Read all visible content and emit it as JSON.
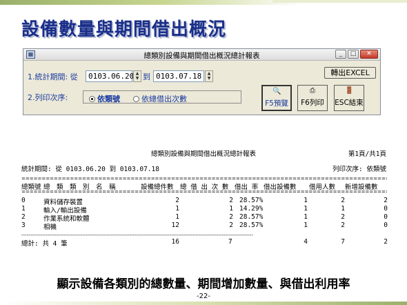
{
  "slide": {
    "title": "設備數量與期間借出概況",
    "caption": "顯示設備各類別的總數量、期間增加數量、與借出利用率",
    "page_number": "-22-"
  },
  "window": {
    "title": "總類別設備與期間借出概況總計報表",
    "controls": {
      "minimize": "_",
      "maximize": "□",
      "close": "✕"
    },
    "period_label": "1.統計期間: 從",
    "date_from": "0103.06.20",
    "to_label": "到",
    "date_to": "0103.07.18",
    "order_label": "2.列印次序:",
    "radio_options": [
      {
        "label": "依類號",
        "selected": true
      },
      {
        "label": "依總借出次數",
        "selected": false
      }
    ],
    "buttons": {
      "excel": "轉出EXCEL",
      "preview": "F5預覽",
      "print": "F6列印",
      "exit": "ESC結束"
    }
  },
  "report": {
    "title": "總類別設備與期間借出概況總計報表",
    "page": "第1頁/共1頁",
    "period": "統計期間: 從 0103.06.20 到 0103.07.18",
    "order": "列印次序: 依類號",
    "columns": [
      "總類號",
      "總　類　類　別　名　稱",
      "設備總件數",
      "總 借 出 次 數",
      "借出 率",
      "借出設備數",
      "借用人數",
      "新增設備數"
    ],
    "rows": [
      {
        "code": "0",
        "name": "資料儲存裝置",
        "total": "2",
        "loans": "2",
        "rate": "28.57%",
        "loaned": "1",
        "borrowers": "2",
        "added": "2"
      },
      {
        "code": "1",
        "name": "輸入/輸出設備",
        "total": "1",
        "loans": "1",
        "rate": "14.29%",
        "loaned": "1",
        "borrowers": "1",
        "added": "0"
      },
      {
        "code": "2",
        "name": "作業系統和軟體",
        "total": "1",
        "loans": "2",
        "rate": "28.57%",
        "loaned": "1",
        "borrowers": "2",
        "added": "0"
      },
      {
        "code": "3",
        "name": "相機",
        "total": "12",
        "loans": "2",
        "rate": "28.57%",
        "loaned": "1",
        "borrowers": "2",
        "added": "0"
      }
    ],
    "totals": {
      "label": "總計: 共 4 筆",
      "total": "16",
      "loans": "7",
      "loaned": "4",
      "borrowers": "7",
      "added": "2"
    }
  }
}
